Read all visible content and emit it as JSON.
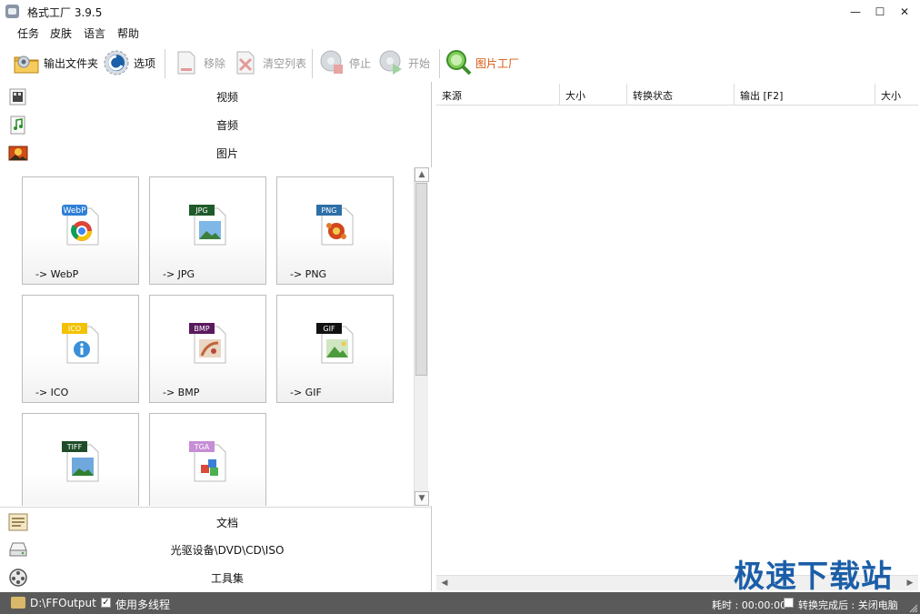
{
  "window": {
    "title": "格式工厂 3.9.5",
    "minimize": "—",
    "maximize": "☐",
    "close": "✕"
  },
  "menu": {
    "items": [
      "任务",
      "皮肤",
      "语言",
      "帮助"
    ]
  },
  "toolbar": {
    "output_folder": "输出文件夹",
    "options": "选项",
    "remove": "移除",
    "clear_list": "清空列表",
    "stop": "停止",
    "start": "开始",
    "picture_factory": "图片工厂"
  },
  "categories": {
    "video": "视频",
    "audio": "音频",
    "picture": "图片",
    "document": "文档",
    "rom": "光驱设备\\DVD\\CD\\ISO",
    "tools": "工具集"
  },
  "tiles": [
    {
      "badge": "WebP",
      "label": "-> WebP",
      "badge_color": "#2f7fd6",
      "icon": "webp-chrome-icon"
    },
    {
      "badge": "JPG",
      "label": "-> JPG",
      "badge_color": "#1f5a2a",
      "icon": "jpg-landscape-icon"
    },
    {
      "badge": "PNG",
      "label": "-> PNG",
      "badge_color": "#2e6fa8",
      "icon": "png-flower-icon"
    },
    {
      "badge": "ICO",
      "label": "-> ICO",
      "badge_color": "#f2c200",
      "icon": "ico-info-icon"
    },
    {
      "badge": "BMP",
      "label": "-> BMP",
      "badge_color": "#5a1a5e",
      "icon": "bmp-palette-icon"
    },
    {
      "badge": "GIF",
      "label": "-> GIF",
      "badge_color": "#111111",
      "icon": "gif-image-icon"
    },
    {
      "badge": "TIFF",
      "label": "",
      "badge_color": "#1f4d2a",
      "icon": "tiff-landscape-icon"
    },
    {
      "badge": "TGA",
      "label": "",
      "badge_color": "#c68ed6",
      "icon": "tga-shapes-icon"
    }
  ],
  "task_list": {
    "columns": [
      "来源",
      "大小",
      "转换状态",
      "输出 [F2]",
      "大小"
    ]
  },
  "watermark": "极速下载站",
  "statusbar": {
    "output_path": "D:\\FFOutput",
    "multithread_label": "使用多线程",
    "multithread_checked": "✓",
    "elapsed": "耗时 : 00:00:00",
    "after_done": "转换完成后 : 关闭电脑"
  }
}
